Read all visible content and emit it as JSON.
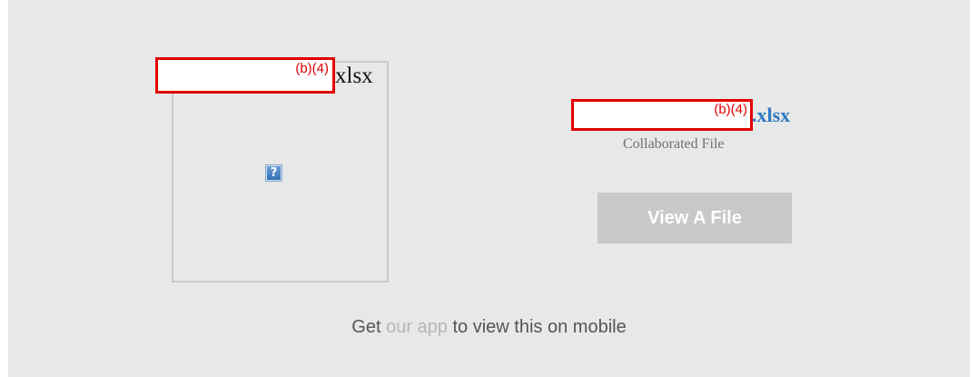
{
  "preview": {
    "filename_suffix": "xlsx",
    "redaction_label": "(b)(4)",
    "icon": "broken-image-question-icon",
    "icon_glyph": "?"
  },
  "file_info": {
    "redaction_label": "(b)(4)",
    "extension": ".xlsx",
    "subtitle": "Collaborated File",
    "view_button_label": "View A File"
  },
  "footer": {
    "prefix": "Get",
    "link_text": "our app",
    "suffix": "to view this on mobile"
  },
  "colors": {
    "panel_background": "#e7e8e8",
    "redaction_border": "#e20000",
    "file_extension": "#2f78c2",
    "button_background": "#c8c8c8",
    "link": "#b7b7b7"
  }
}
